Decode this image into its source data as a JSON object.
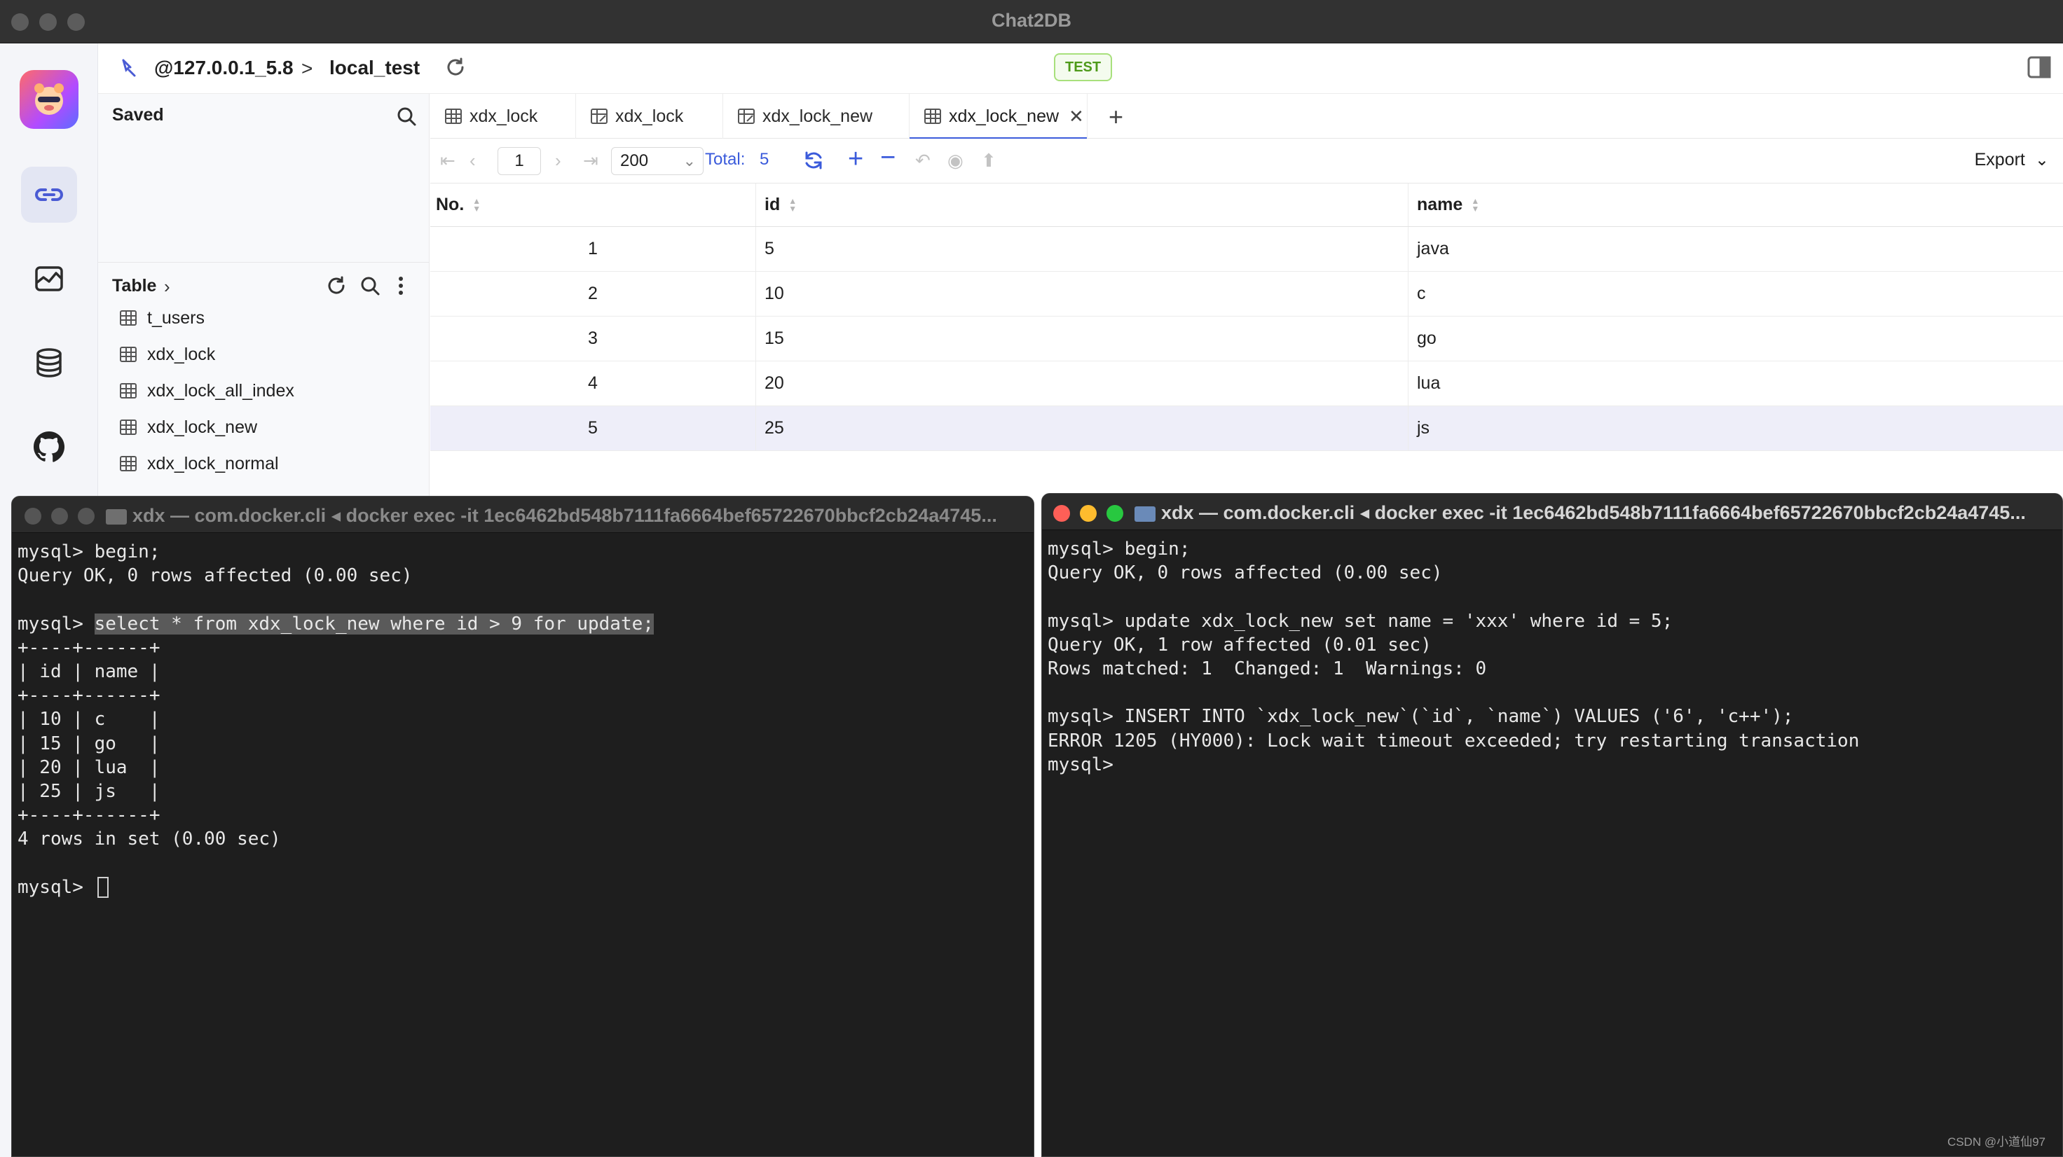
{
  "app": {
    "title": "Chat2DB"
  },
  "header": {
    "connection": "@127.0.0.1_5.8",
    "separator": ">",
    "database": "local_test",
    "env_badge": "TEST"
  },
  "sidebar": {
    "saved_title": "Saved",
    "table_title": "Table",
    "tables": [
      "t_users",
      "xdx_lock",
      "xdx_lock_all_index",
      "xdx_lock_new",
      "xdx_lock_normal"
    ]
  },
  "tabs": [
    {
      "label": "xdx_lock",
      "active": false
    },
    {
      "label": "xdx_lock",
      "active": false
    },
    {
      "label": "xdx_lock_new",
      "active": false
    },
    {
      "label": "xdx_lock_new",
      "active": true
    }
  ],
  "toolbar": {
    "page": "1",
    "page_size": "200",
    "total_label": "Total:",
    "total_value": "5",
    "export_label": "Export"
  },
  "grid": {
    "columns": [
      "No.",
      "id",
      "name"
    ],
    "rows": [
      [
        "1",
        "5",
        "java"
      ],
      [
        "2",
        "10",
        "c"
      ],
      [
        "3",
        "15",
        "go"
      ],
      [
        "4",
        "20",
        "lua"
      ],
      [
        "5",
        "25",
        "js"
      ]
    ]
  },
  "terminal_left": {
    "title": "xdx — com.docker.cli ◂ docker exec -it 1ec6462bd548b7111fa6664bef65722670bbcf2cb24a4745...",
    "lines": [
      "mysql> begin;",
      "Query OK, 0 rows affected (0.00 sec)",
      "",
      "mysql> ",
      "+----+------+",
      "| id | name |",
      "+----+------+",
      "| 10 | c    |",
      "| 15 | go   |",
      "| 20 | lua  |",
      "| 25 | js   |",
      "+----+------+",
      "4 rows in set (0.00 sec)",
      "",
      "mysql> "
    ],
    "highlighted_command": "select * from xdx_lock_new where id > 9 for update;"
  },
  "terminal_right": {
    "title": "xdx — com.docker.cli ◂ docker exec -it 1ec6462bd548b7111fa6664bef65722670bbcf2cb24a4745...",
    "lines": [
      "mysql> begin;",
      "Query OK, 0 rows affected (0.00 sec)",
      "",
      "mysql> update xdx_lock_new set name = 'xxx' where id = 5;",
      "Query OK, 1 row affected (0.01 sec)",
      "Rows matched: 1  Changed: 1  Warnings: 0",
      "",
      "mysql> INSERT INTO `xdx_lock_new`(`id`, `name`) VALUES ('6', 'c++');",
      "ERROR 1205 (HY000): Lock wait timeout exceeded; try restarting transaction",
      "mysql> "
    ]
  },
  "watermark": "CSDN @小道仙97",
  "colors": {
    "accent": "#3b5bdb",
    "badge_green": "#4e9a1a",
    "terminal_bg": "#1e1e1e"
  }
}
